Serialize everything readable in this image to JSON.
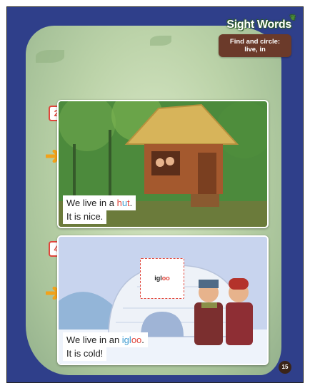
{
  "banner": {
    "title": "Sight Words",
    "instruction": "Find and circle: live, in"
  },
  "panels": [
    {
      "number": "2",
      "caption_line1_prefix": "We live in a ",
      "caption_word_part1": "h",
      "caption_word_part2": "u",
      "caption_word_part3": "t",
      "caption_line1_suffix": ".",
      "caption_line2": "It is nice."
    },
    {
      "number": "4",
      "label_part1": "igl",
      "label_part2": "oo",
      "caption_line1_prefix": "We live in an ",
      "caption_word_part1": "igl",
      "caption_word_part2": "oo",
      "caption_line1_suffix": ".",
      "caption_line2": "It is cold!"
    }
  ],
  "page_number": "15",
  "colors": {
    "frame": "#2f3f8a",
    "accent_red": "#e0463c",
    "accent_blue": "#3d9bd1",
    "banner_brown": "#6b3a2a",
    "arrow": "#f2a21b"
  }
}
